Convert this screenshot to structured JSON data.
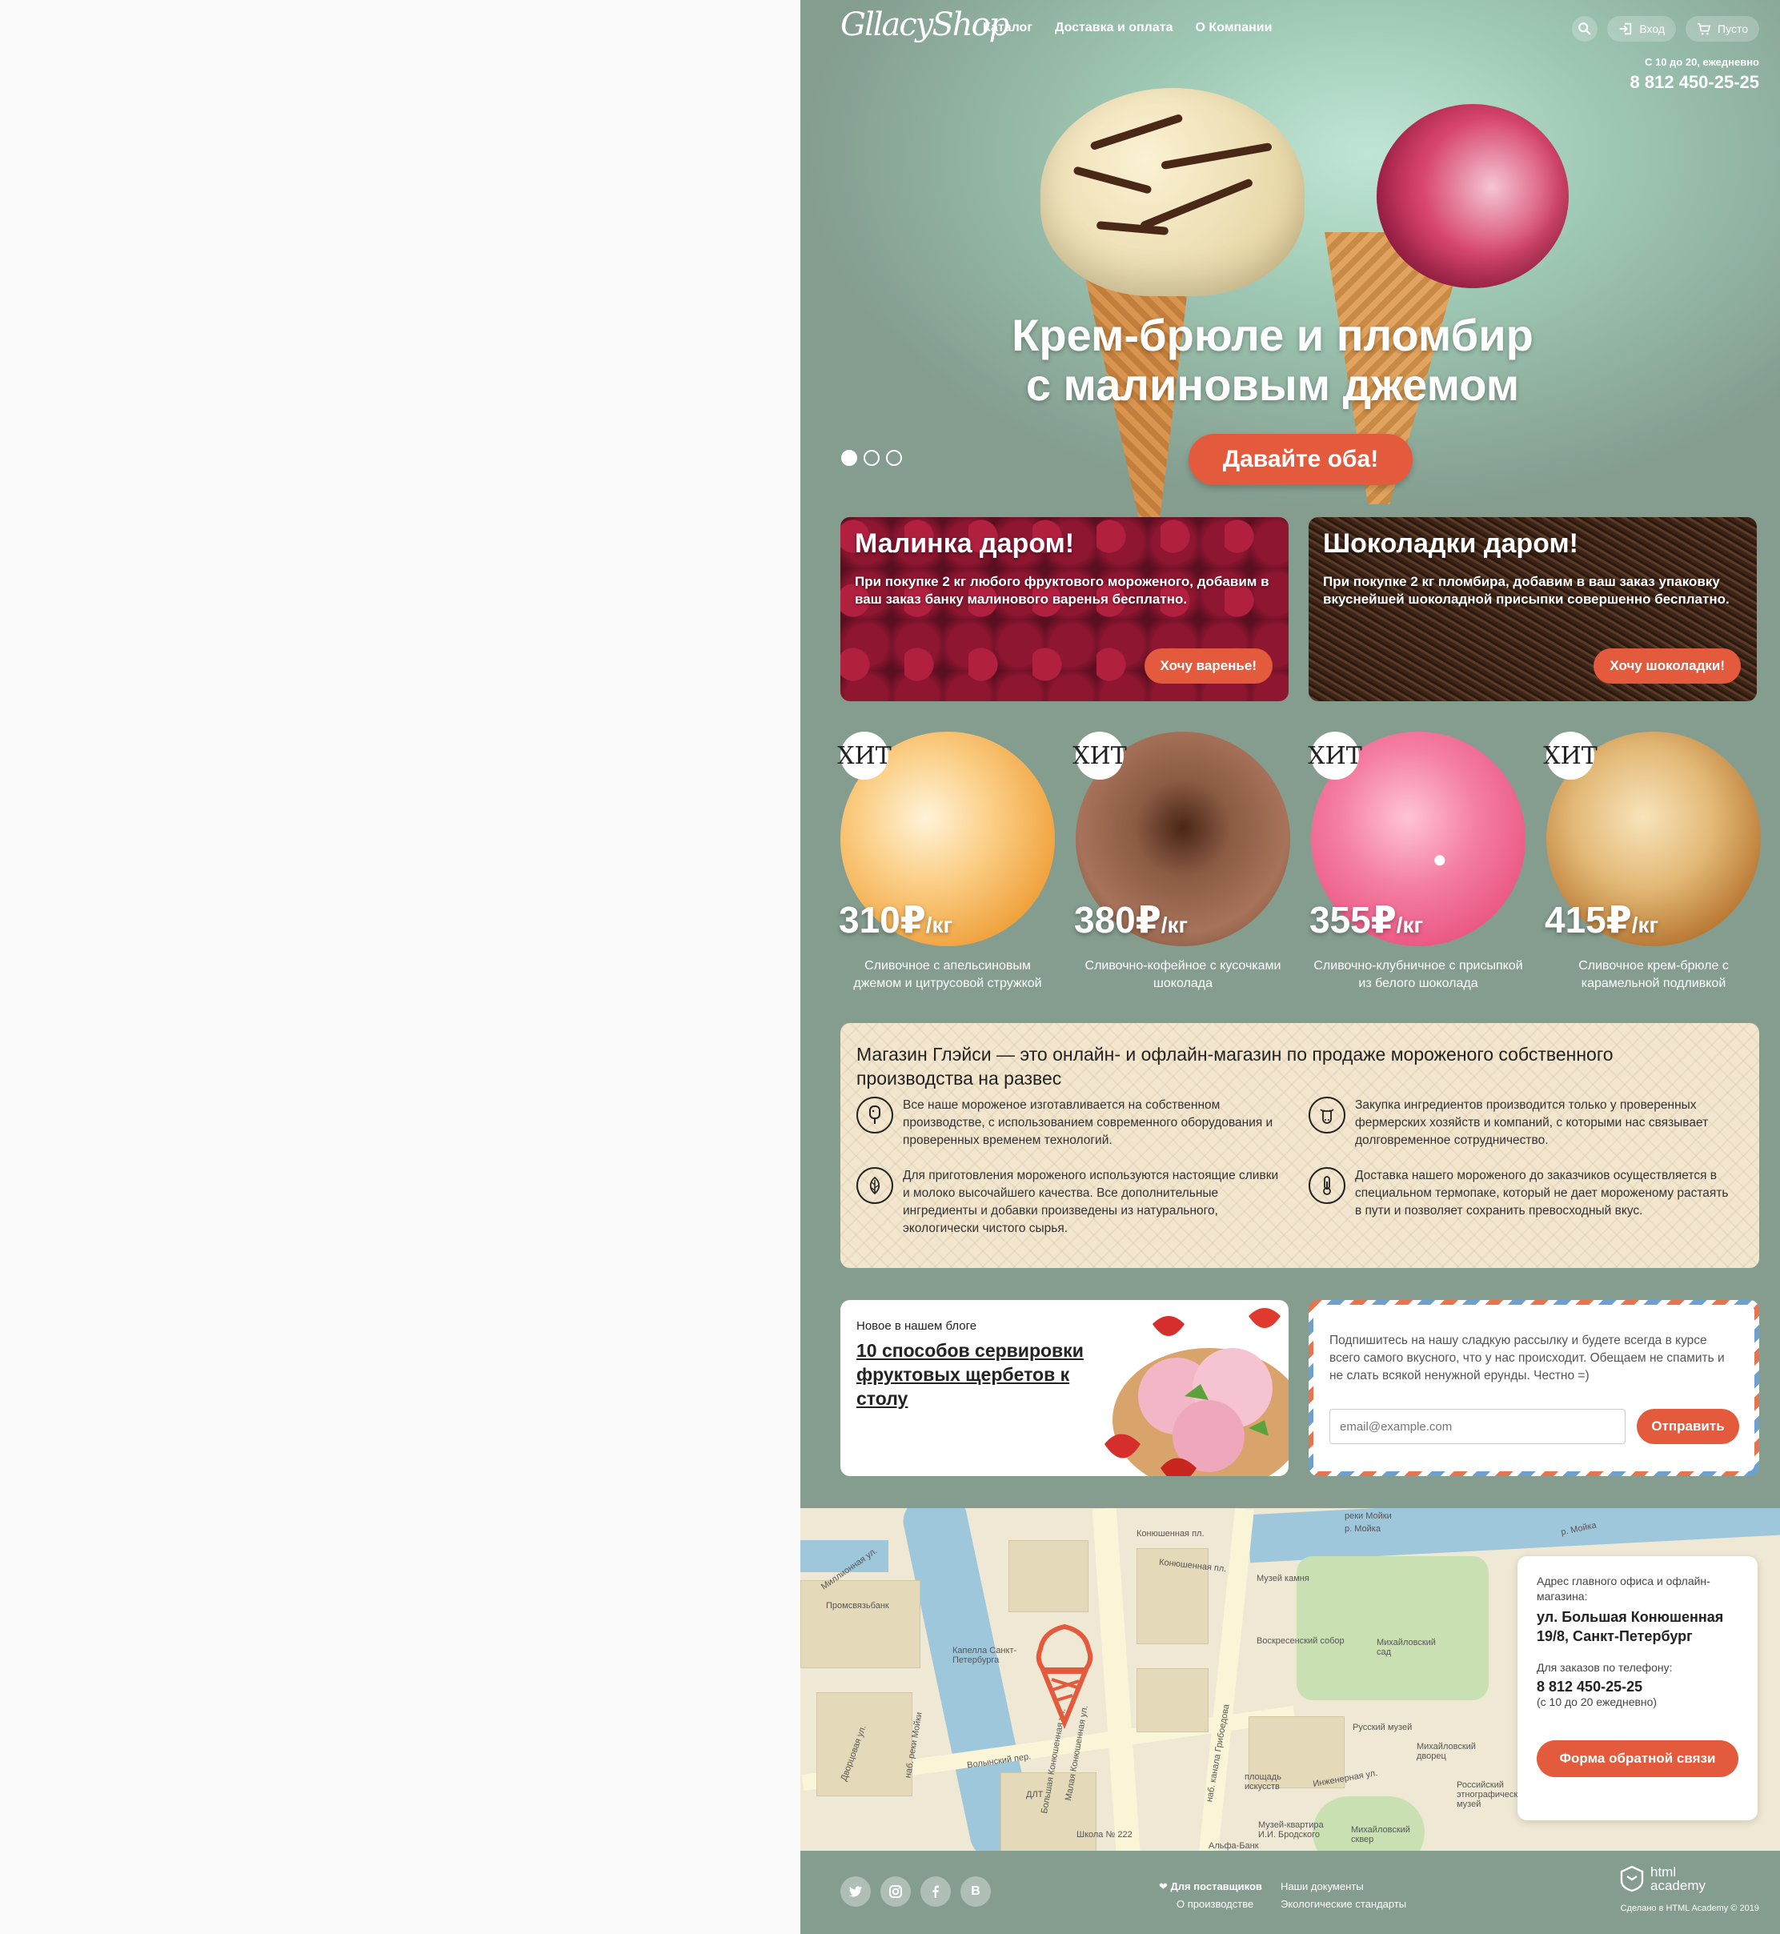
{
  "header": {
    "logo": "GllacyShop",
    "nav": [
      "Каталог",
      "Доставка и оплата",
      "О Компании"
    ],
    "login_label": "Вход",
    "cart_label": "Пусто",
    "hours": "С 10 до 20, ежедневно",
    "phone": "8 812 450-25-25"
  },
  "hero": {
    "title_line1": "Крем-брюле и пломбир",
    "title_line2": "с малиновым джемом",
    "button": "Давайте оба!",
    "slides": 3,
    "active_slide": 1
  },
  "promos": [
    {
      "title": "Малинка даром!",
      "text": "При покупке 2 кг любого фруктового мороженого, добавим в ваш заказ банку малинового варенья бесплатно.",
      "button": "Хочу варенье!"
    },
    {
      "title": "Шоколадки даром!",
      "text": "При покупке 2 кг пломбира, добавим в ваш заказ упаковку вкуснейшей шоколадной присыпки совершенно бесплатно.",
      "button": "Хочу шоколадки!"
    }
  ],
  "products": [
    {
      "badge": "ХИТ",
      "price": "310",
      "currency": "₽",
      "unit": "/кг",
      "name": "Сливочное с апельсиновым джемом и цитрусовой стружкой",
      "color": "#f5b55c"
    },
    {
      "badge": "ХИТ",
      "price": "380",
      "currency": "₽",
      "unit": "/кг",
      "name": "Сливочно-кофейное с кусочками шоколада",
      "color": "#8a5a43"
    },
    {
      "badge": "ХИТ",
      "price": "355",
      "currency": "₽",
      "unit": "/кг",
      "name": "Сливочно-клубничное с присыпкой из белого шоколада",
      "color": "#f279a0"
    },
    {
      "badge": "ХИТ",
      "price": "415",
      "currency": "₽",
      "unit": "/кг",
      "name": "Сливочное крем-брюле с карамельной подливкой",
      "color": "#d7a363"
    }
  ],
  "about": {
    "title": "Магазин Глэйси — это онлайн- и офлайн-магазин по продаже мороженого собственного производства на развес",
    "features": [
      {
        "icon": "popsicle-icon",
        "text": "Все наше мороженое изготавливается на собственном производстве, с использованием современного оборудования и проверенных временем технологий."
      },
      {
        "icon": "cow-icon",
        "text": "Закупка ингредиентов  производится только у проверенных фермерских хозяйств и компаний, с которыми нас связывает долговременное сотрудничество."
      },
      {
        "icon": "leaf-icon",
        "text": "Для приготовления мороженого используются настоящие сливки и молоко высочайшего качества. Все дополнительные ингредиенты и добавки произведены из натурального, экологически чистого сырья."
      },
      {
        "icon": "thermometer-icon",
        "text": "Доставка нашего мороженого до заказчиков осуществляется в специальном термопаке, который не дает мороженому растаять в пути и позволяет сохранить превосходный вкус."
      }
    ]
  },
  "blog": {
    "kicker": "Новое в нашем блоге",
    "title": "10 способов сервировки фруктовых щербетов к столу"
  },
  "subscribe": {
    "text": "Подпишитесь на нашу сладкую рассылку и будете всегда в курсе всего самого вкусного, что у нас происходит. Обещаем не спамить и не слать всякой ненужной ерунды. Честно =)",
    "placeholder": "email@example.com",
    "button": "Отправить"
  },
  "map": {
    "labels": [
      "реки Мойки",
      "Конюшенная пл.",
      "Конюшенная пл.",
      "Музей камня",
      "р. Мойка",
      "р. Мойка",
      "Миллионная ул.",
      "Промсвязьбанк",
      "Капелла Санкт-Петербурга",
      "Воскресенский собор",
      "Михайловский сад",
      "Русский музей",
      "Михайловский дворец",
      "Волынский пер.",
      "ДЛТ",
      "Большая Конюшенная ул.",
      "Малая Конюшенная ул.",
      "наб. канала Грибоедова",
      "Инженерная ул.",
      "Российский этнографический музей",
      "Музей-квартира И.И. Бродского",
      "Михайловский сквер",
      "Школа № 222",
      "Альфа-Банк",
      "площадь искусств",
      "наб. реки Мойки",
      "Двоpцовая ул."
    ]
  },
  "contacts": {
    "address_label": "Адрес главного офиса и офлайн-магазина:",
    "address": "ул. Большая Конюшенная 19/8, Санкт-Петербург",
    "phone_label": "Для заказов по телефону:",
    "phone": "8 812 450-25-25",
    "hours": "(с 10 до 20 ежедневно)",
    "button": "Форма обратной связи"
  },
  "footer": {
    "social": [
      "twitter-icon",
      "instagram-icon",
      "facebook-icon",
      "vk-icon"
    ],
    "vk_letter": "В",
    "links_col1": [
      "Для поставщиков",
      "О производстве"
    ],
    "links_col2": [
      "Наши документы",
      "Экологические стандарты"
    ],
    "academy": "html academy",
    "credit": "Сделано в HTML Academy © 2019"
  },
  "colors": {
    "page_bg": "#849d8f",
    "accent": "#e45a3c",
    "white": "#ffffff"
  }
}
